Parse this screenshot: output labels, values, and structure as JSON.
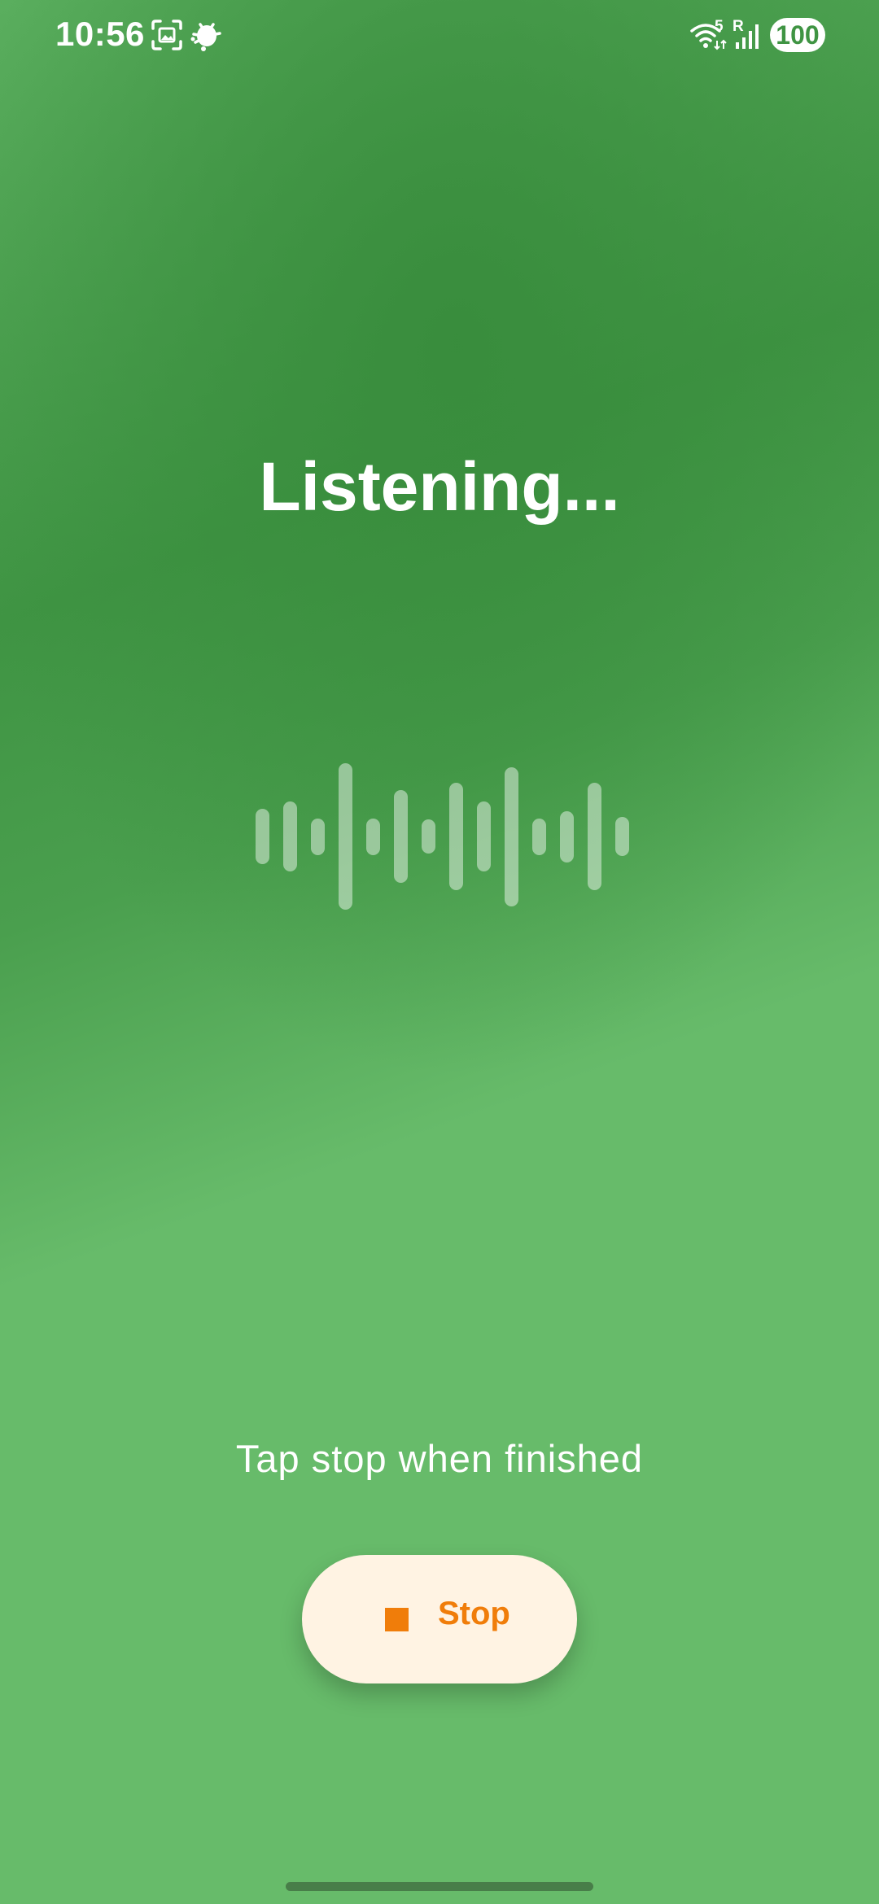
{
  "status_bar": {
    "time": "10:56",
    "left_icons": [
      "screenshot-icon",
      "bug-notification-icon"
    ],
    "right_icons": [
      "wifi-icon",
      "cellular-signal-icon"
    ],
    "wifi_badge": "5",
    "signal_badge": "R",
    "battery": "100"
  },
  "main": {
    "title": "Listening...",
    "waveform_levels": [
      0.38,
      0.48,
      0.25,
      1.0,
      0.25,
      0.63,
      0.23,
      0.73,
      0.48,
      0.95,
      0.25,
      0.35,
      0.73,
      0.27
    ],
    "hint": "Tap stop when finished",
    "stop_button": {
      "label": "Stop",
      "icon": "stop-icon"
    }
  },
  "colors": {
    "background": "#67bb6a",
    "background_dark": "#3f9443",
    "button_bg": "#fff3e3",
    "accent": "#f07d0a"
  }
}
